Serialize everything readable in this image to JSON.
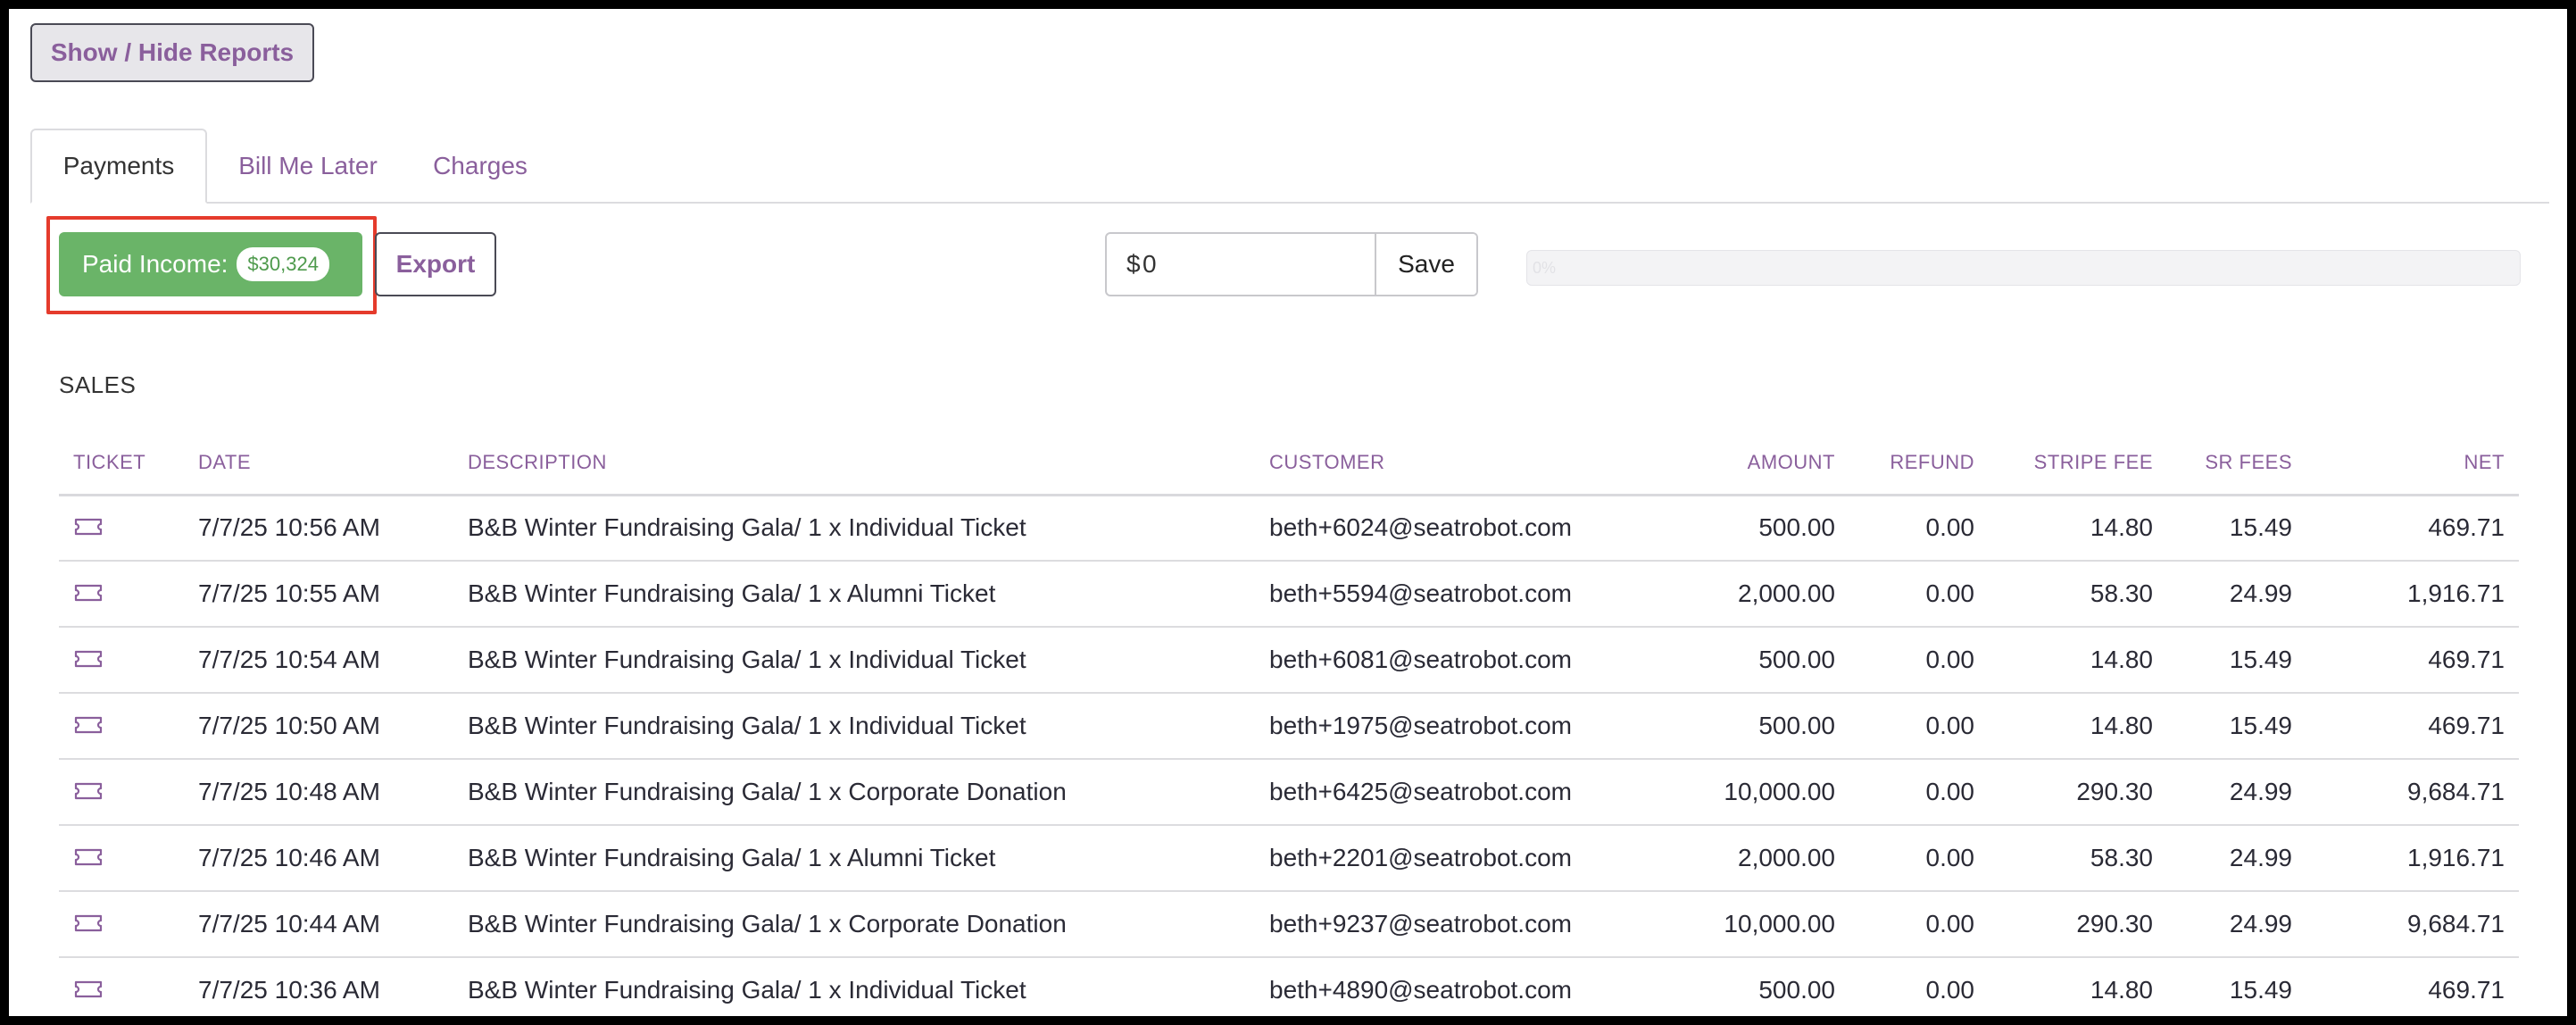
{
  "toolbar": {
    "show_hide_label": "Show / Hide Reports"
  },
  "tabs": [
    {
      "label": "Payments",
      "active": true
    },
    {
      "label": "Bill Me Later",
      "active": false
    },
    {
      "label": "Charges",
      "active": false
    }
  ],
  "summary": {
    "paid_income_label": "Paid Income:",
    "paid_income_value": "$30,324",
    "export_label": "Export"
  },
  "goal": {
    "currency_prefix": "$",
    "value": "0",
    "save_label": "Save",
    "progress_label": "0%",
    "progress_fraction": 0
  },
  "sales": {
    "title": "SALES",
    "columns": [
      "TICKET",
      "DATE",
      "DESCRIPTION",
      "CUSTOMER",
      "AMOUNT",
      "REFUND",
      "STRIPE FEE",
      "SR FEES",
      "NET"
    ],
    "rows": [
      {
        "date": "7/7/25 10:56 AM",
        "description": "B&B Winter Fundraising Gala/ 1 x Individual Ticket",
        "customer": "beth+6024@seatrobot.com",
        "amount": "500.00",
        "refund": "0.00",
        "stripe_fee": "14.80",
        "sr_fees": "15.49",
        "net": "469.71"
      },
      {
        "date": "7/7/25 10:55 AM",
        "description": "B&B Winter Fundraising Gala/ 1 x Alumni Ticket",
        "customer": "beth+5594@seatrobot.com",
        "amount": "2,000.00",
        "refund": "0.00",
        "stripe_fee": "58.30",
        "sr_fees": "24.99",
        "net": "1,916.71"
      },
      {
        "date": "7/7/25 10:54 AM",
        "description": "B&B Winter Fundraising Gala/ 1 x Individual Ticket",
        "customer": "beth+6081@seatrobot.com",
        "amount": "500.00",
        "refund": "0.00",
        "stripe_fee": "14.80",
        "sr_fees": "15.49",
        "net": "469.71"
      },
      {
        "date": "7/7/25 10:50 AM",
        "description": "B&B Winter Fundraising Gala/ 1 x Individual Ticket",
        "customer": "beth+1975@seatrobot.com",
        "amount": "500.00",
        "refund": "0.00",
        "stripe_fee": "14.80",
        "sr_fees": "15.49",
        "net": "469.71"
      },
      {
        "date": "7/7/25 10:48 AM",
        "description": "B&B Winter Fundraising Gala/ 1 x Corporate Donation",
        "customer": "beth+6425@seatrobot.com",
        "amount": "10,000.00",
        "refund": "0.00",
        "stripe_fee": "290.30",
        "sr_fees": "24.99",
        "net": "9,684.71"
      },
      {
        "date": "7/7/25 10:46 AM",
        "description": "B&B Winter Fundraising Gala/ 1 x Alumni Ticket",
        "customer": "beth+2201@seatrobot.com",
        "amount": "2,000.00",
        "refund": "0.00",
        "stripe_fee": "58.30",
        "sr_fees": "24.99",
        "net": "1,916.71"
      },
      {
        "date": "7/7/25 10:44 AM",
        "description": "B&B Winter Fundraising Gala/ 1 x Corporate Donation",
        "customer": "beth+9237@seatrobot.com",
        "amount": "10,000.00",
        "refund": "0.00",
        "stripe_fee": "290.30",
        "sr_fees": "24.99",
        "net": "9,684.71"
      },
      {
        "date": "7/7/25 10:36 AM",
        "description": "B&B Winter Fundraising Gala/ 1 x Individual Ticket",
        "customer": "beth+4890@seatrobot.com",
        "amount": "500.00",
        "refund": "0.00",
        "stripe_fee": "14.80",
        "sr_fees": "15.49",
        "net": "469.71"
      }
    ]
  },
  "colors": {
    "accent_purple": "#8a5f9c",
    "success_green": "#6ab468",
    "highlight_red": "#e53b2c"
  },
  "icons": {
    "ticket": "ticket-icon"
  }
}
